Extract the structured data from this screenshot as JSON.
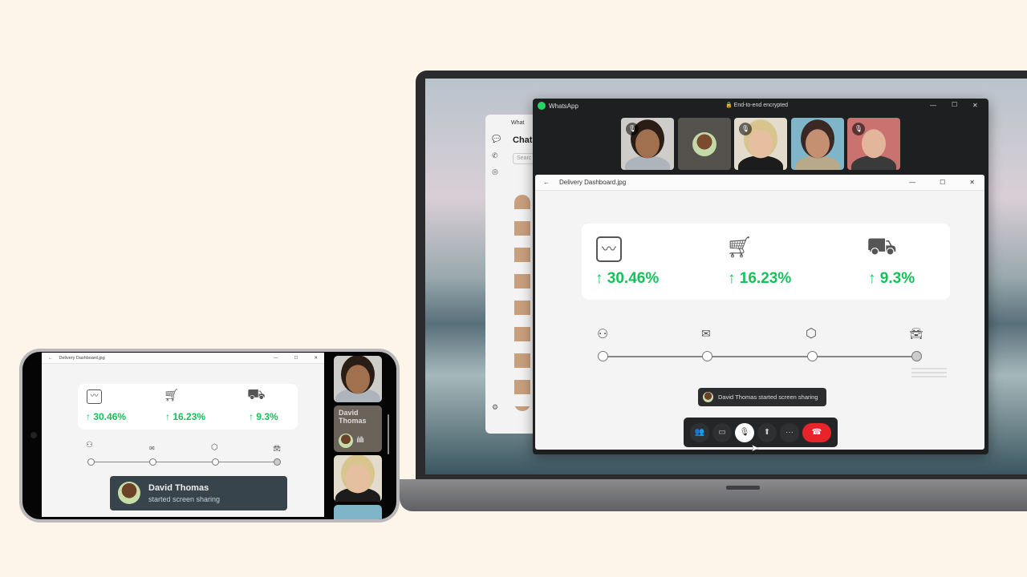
{
  "call_window": {
    "app_title": "WhatsApp",
    "encryption": "End-to-end encrypted",
    "minimize": "—",
    "maximize": "☐",
    "close": "✕"
  },
  "chat_window": {
    "app_title": "What",
    "heading": "Chat",
    "search_placeholder": "Searc"
  },
  "viewer": {
    "back": "←",
    "title": "Delivery Dashboard.jpg",
    "minimize": "—",
    "maximize": "☐",
    "close": "✕"
  },
  "dashboard": {
    "stats": [
      {
        "icon": "chart-icon",
        "value": "↑ 30.46%"
      },
      {
        "icon": "cart-icon",
        "value": "↑ 16.23%"
      },
      {
        "icon": "truck-icon",
        "value": "↑ 9.3%"
      }
    ],
    "timeline": [
      {
        "icon": "person-icon",
        "done": true
      },
      {
        "icon": "package-icon",
        "done": true
      },
      {
        "icon": "box-icon",
        "done": true
      },
      {
        "icon": "car-icon",
        "done": false
      }
    ]
  },
  "toast": {
    "text": "David Thomas started screen sharing"
  },
  "controls": [
    {
      "name": "participants",
      "glyph": "👥"
    },
    {
      "name": "video",
      "glyph": "▭"
    },
    {
      "name": "mute",
      "glyph": "🎙"
    },
    {
      "name": "share-screen",
      "glyph": "⬆"
    },
    {
      "name": "more",
      "glyph": "···"
    },
    {
      "name": "end-call",
      "glyph": "☎"
    }
  ],
  "phone": {
    "viewer_title": "Delivery Dashboard.jpg",
    "speaker_name": "David Thomas",
    "toast_name": "David Thomas",
    "toast_sub": "started screen sharing"
  },
  "colors": {
    "accent_green": "#16c15a",
    "end_call_red": "#e8232a",
    "toast_bg": "#37444b"
  }
}
